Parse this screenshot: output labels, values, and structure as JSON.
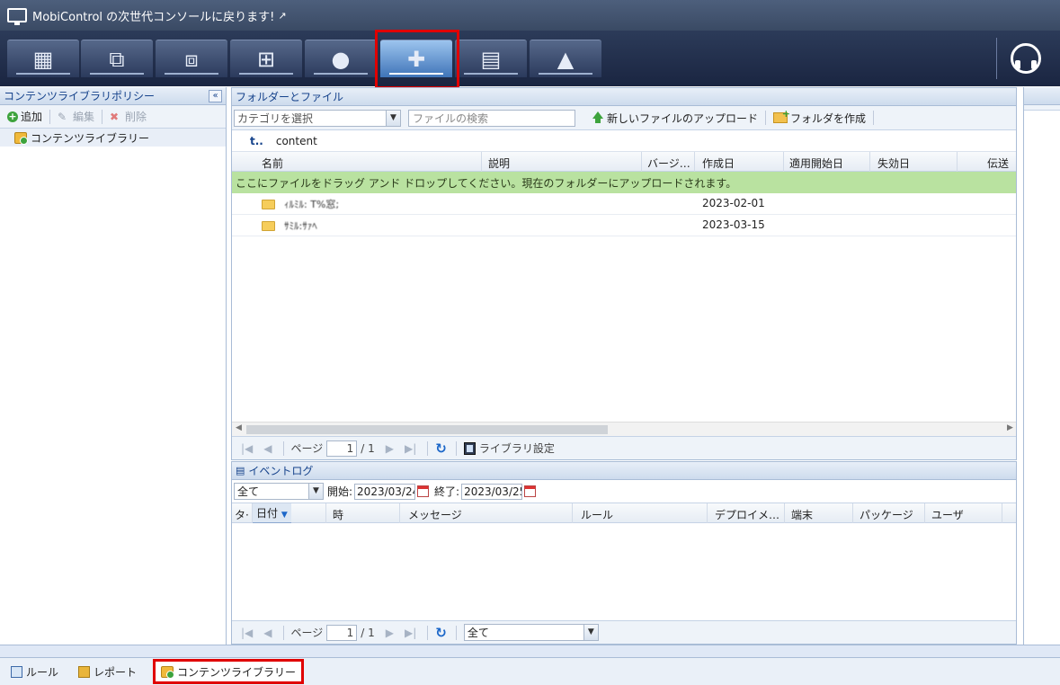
{
  "banner": {
    "title": "MobiControl の次世代コンソールに戻ります!",
    "external_icon": "external-link-icon"
  },
  "os_tabs": [
    {
      "name": "all-devices",
      "glyph": "▦",
      "icon": "grid-icon"
    },
    {
      "name": "windows-modern",
      "glyph": "⧉",
      "icon": "windows-modern-icon"
    },
    {
      "name": "windows-classic",
      "glyph": "⧈",
      "icon": "windows-classic-icon"
    },
    {
      "name": "windows",
      "glyph": "⊞",
      "icon": "windows-icon"
    },
    {
      "name": "apple",
      "glyph": "●",
      "icon": "apple-icon"
    },
    {
      "name": "android",
      "glyph": "✚",
      "icon": "android-icon"
    },
    {
      "name": "windows-mobile",
      "glyph": "▤",
      "icon": "windows-mobile-icon"
    },
    {
      "name": "linux",
      "glyph": "▲",
      "icon": "linux-icon"
    }
  ],
  "active_os_tab": "android",
  "left": {
    "title": "コンテンツライブラリポリシー",
    "collapse": "«",
    "toolbar": {
      "add": "追加",
      "edit": "編集",
      "delete": "削除"
    },
    "tree": [
      {
        "label": "コンテンツライブラリー"
      }
    ]
  },
  "center": {
    "title": "フォルダーとファイル",
    "category_placeholder": "カテゴリを選択",
    "search_placeholder": "ファイルの検索",
    "upload_label": "新しいファイルのアップロード",
    "create_folder_label": "フォルダを作成",
    "path_up": "t..",
    "path": "content",
    "columns": [
      "名前",
      "説明",
      "バージ…",
      "作成日",
      "適用開始日",
      "失効日",
      "伝送"
    ],
    "drop_message": "ここにファイルをドラッグ アンド ドロップしてください。現在のフォルダーにアップロードされます。",
    "rows": [
      {
        "name": "ｨﾙﾐﾙ: T%窓;",
        "date": "2023-02-01"
      },
      {
        "name": "ｻﾐﾙ:ｻｧﾍ",
        "date": "2023-03-15"
      }
    ],
    "pager": {
      "page_label": "ページ",
      "page_value": "1",
      "page_total": "/ 1",
      "library_settings": "ライブラリ設定"
    }
  },
  "events": {
    "title": "イベントログ",
    "filter_value": "全て",
    "start_label": "開始:",
    "start_value": "2023/03/24",
    "end_label": "終了:",
    "end_value": "2023/03/25",
    "columns": [
      "タ·",
      "日付",
      "時",
      "メッセージ",
      "ルール",
      "デプロイメ…",
      "端末",
      "パッケージ",
      "ユーザ"
    ],
    "pager": {
      "page_label": "ページ",
      "page_value": "1",
      "page_total": "/ 1",
      "filter_value": "全て"
    }
  },
  "bottom_tabs": [
    {
      "label": "ルール",
      "icon": "rule-icon"
    },
    {
      "label": "レポート",
      "icon": "report-icon"
    },
    {
      "label": "コンテンツライブラリー",
      "icon": "content-library-icon",
      "active": true
    }
  ],
  "colors": {
    "highlight": "#e00000",
    "drop_banner": "#b9e2a0",
    "header_blue": "#15428b"
  }
}
